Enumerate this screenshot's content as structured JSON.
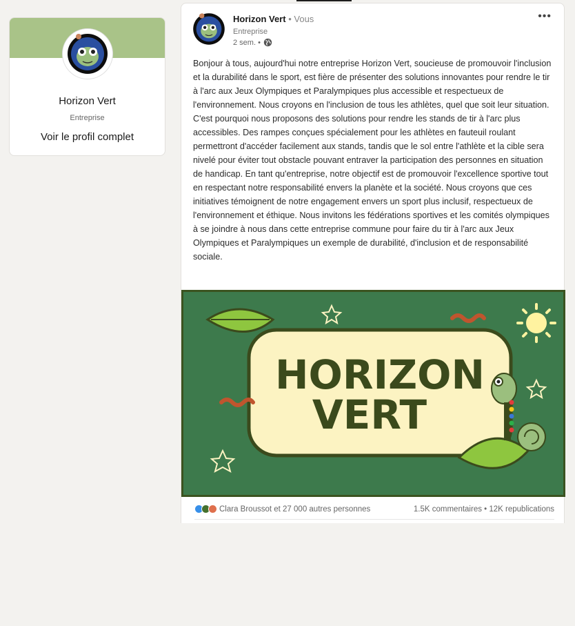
{
  "profile": {
    "name": "Horizon Vert",
    "type": "Entreprise",
    "link": "Voir le profil complet"
  },
  "post": {
    "author": "Horizon Vert",
    "separator": "•",
    "you_label": "Vous",
    "subtitle": "Entreprise",
    "time": "2 sem. •",
    "more": "•••",
    "text": "Bonjour à tous, aujourd'hui notre entreprise Horizon Vert, soucieuse de promouvoir l'inclusion et la durabilité dans le sport, est fière de présenter des solutions innovantes pour rendre le tir à l'arc aux Jeux Olympiques et Paralympiques plus accessible et respectueux de l'environnement. Nous croyons en l'inclusion de tous les athlètes, quel que soit leur situation. C'est pourquoi nous proposons des solutions pour rendre les stands de tir à l'arc plus accessibles. Des rampes conçues spécialement pour les athlètes en fauteuil roulant permettront d'accéder facilement aux stands, tandis que le sol entre l'athlète et la cible sera nivelé pour éviter tout obstacle pouvant entraver la participation des personnes en situation de handicap. En tant qu'entreprise, notre objectif est de promouvoir l'excellence sportive tout en respectant notre responsabilité envers la planète et la société. Nous croyons que ces initiatives témoignent de notre engagement envers un sport plus inclusif, respectueux de l'environnement et éthique. Nous invitons les fédérations sportives et les comités olympiques à se joindre à nous dans cette entreprise commune pour faire du tir à l'arc aux Jeux Olympiques et Paralympiques un exemple de durabilité, d'inclusion et de responsabilité sociale.",
    "image": {
      "line1": "HORIZON",
      "line2": "VERT",
      "bg_color": "#3d7a4c",
      "panel_color": "#fcf3c2",
      "text_color": "#3b4a1c"
    },
    "reactions_text": "Clara Broussot et 27 000 autres personnes",
    "stats_text": "1.5K commentaires • 12K republications",
    "reaction_icons": [
      "like-icon",
      "support-icon",
      "love-icon"
    ]
  }
}
